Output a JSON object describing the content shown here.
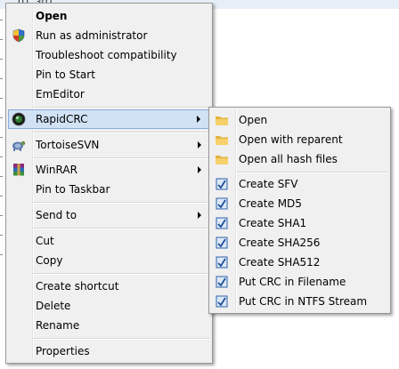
{
  "background": {
    "fragment": "01_301"
  },
  "main_menu": {
    "items": [
      {
        "label": "Open",
        "bold": true
      },
      {
        "label": "Run as administrator",
        "icon": "shield-icon"
      },
      {
        "label": "Troubleshoot compatibility"
      },
      {
        "label": "Pin to Start"
      },
      {
        "label": "EmEditor"
      },
      {
        "label": "RapidCRC",
        "icon": "rapidcrc-icon",
        "submenu": true,
        "highlighted": true
      },
      {
        "label": "TortoiseSVN",
        "icon": "tortoisesvn-icon",
        "submenu": true
      },
      {
        "label": "WinRAR",
        "icon": "winrar-icon",
        "submenu": true
      },
      {
        "label": "Pin to Taskbar"
      },
      {
        "label": "Send to",
        "submenu": true
      },
      {
        "label": "Cut"
      },
      {
        "label": "Copy"
      },
      {
        "label": "Create shortcut"
      },
      {
        "label": "Delete"
      },
      {
        "label": "Rename"
      },
      {
        "label": "Properties"
      }
    ]
  },
  "sub_menu": {
    "items": [
      {
        "label": "Open",
        "icon": "folder-icon"
      },
      {
        "label": "Open with reparent",
        "icon": "folder-icon"
      },
      {
        "label": "Open all hash files",
        "icon": "folder-icon"
      },
      {
        "label": "Create SFV",
        "icon": "checksum-icon"
      },
      {
        "label": "Create MD5",
        "icon": "checksum-icon"
      },
      {
        "label": "Create SHA1",
        "icon": "checksum-icon"
      },
      {
        "label": "Create SHA256",
        "icon": "checksum-icon"
      },
      {
        "label": "Create SHA512",
        "icon": "checksum-icon"
      },
      {
        "label": "Put CRC in Filename",
        "icon": "checksum-icon"
      },
      {
        "label": "Put CRC in NTFS Stream",
        "icon": "checksum-icon"
      }
    ]
  },
  "colors": {
    "menu_bg": "#f0f0f0",
    "highlight": "#d1e2f4",
    "highlight_border": "#84acdd"
  }
}
